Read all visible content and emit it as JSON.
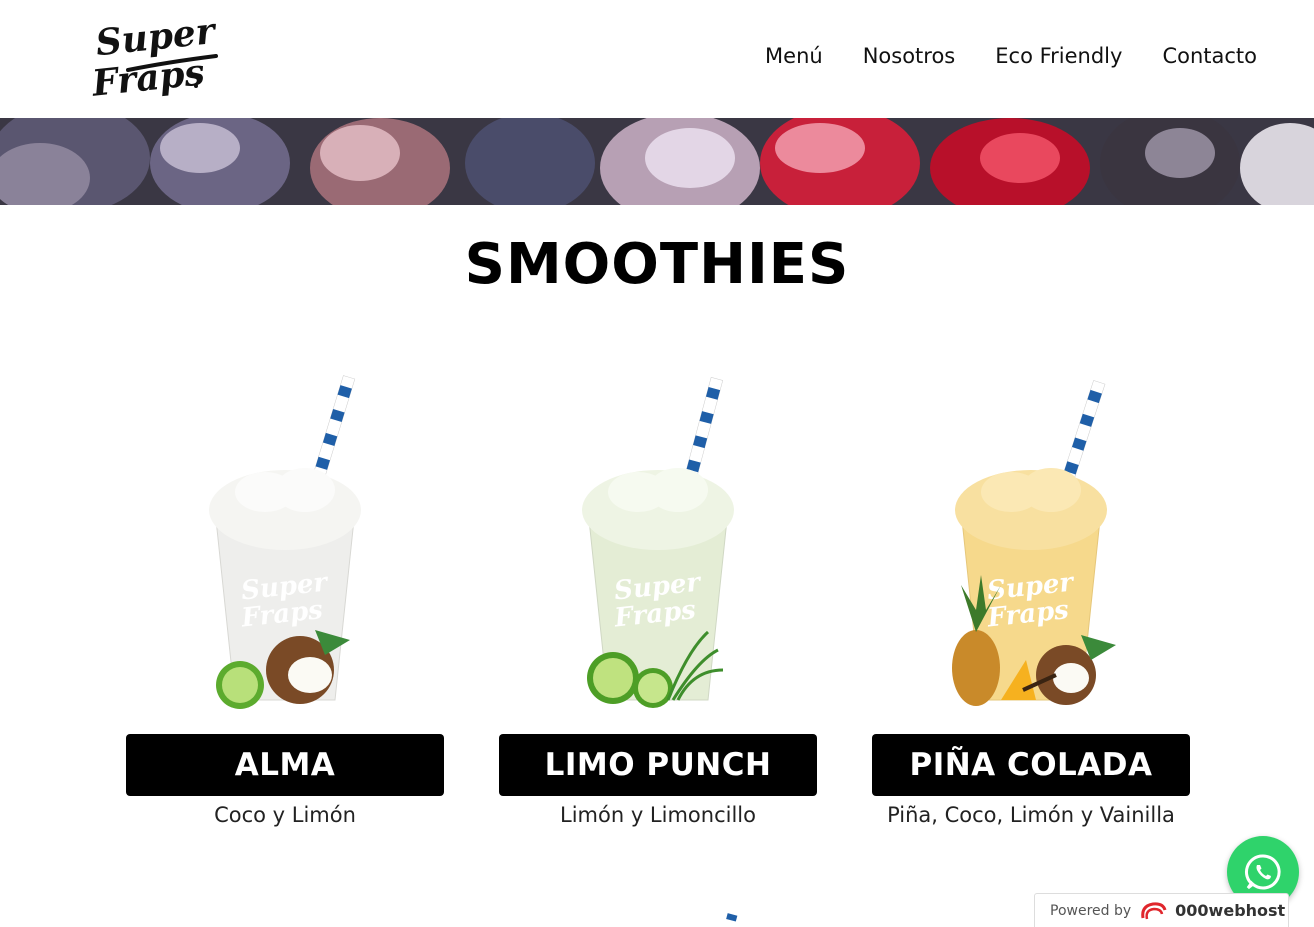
{
  "header": {
    "logo_text_line1": "Super",
    "logo_text_line2": "Fraps",
    "nav": [
      {
        "label": "Menú"
      },
      {
        "label": "Nosotros"
      },
      {
        "label": "Eco Friendly"
      },
      {
        "label": "Contacto"
      }
    ]
  },
  "section": {
    "title": "SMOOTHIES"
  },
  "products": [
    {
      "name": "ALMA",
      "description": "Coco y Limón",
      "drink_color": "#eeeeec",
      "icon": "coconut-lime-icon"
    },
    {
      "name": "LIMO PUNCH",
      "description": "Limón y Limoncillo",
      "drink_color": "#e4edd5",
      "icon": "lime-lemongrass-icon"
    },
    {
      "name": "PIÑA COLADA",
      "description": "Piña, Coco, Limón y Vainilla",
      "drink_color": "#f6d98c",
      "icon": "pineapple-coconut-icon"
    }
  ],
  "widgets": {
    "whatsapp_icon": "whatsapp-icon",
    "powered_by": "Powered by",
    "host_brand": "000webhost"
  },
  "colors": {
    "accent_black": "#000000",
    "whatsapp_green": "#2fd36b",
    "straw_blue": "#1f5fa8"
  }
}
